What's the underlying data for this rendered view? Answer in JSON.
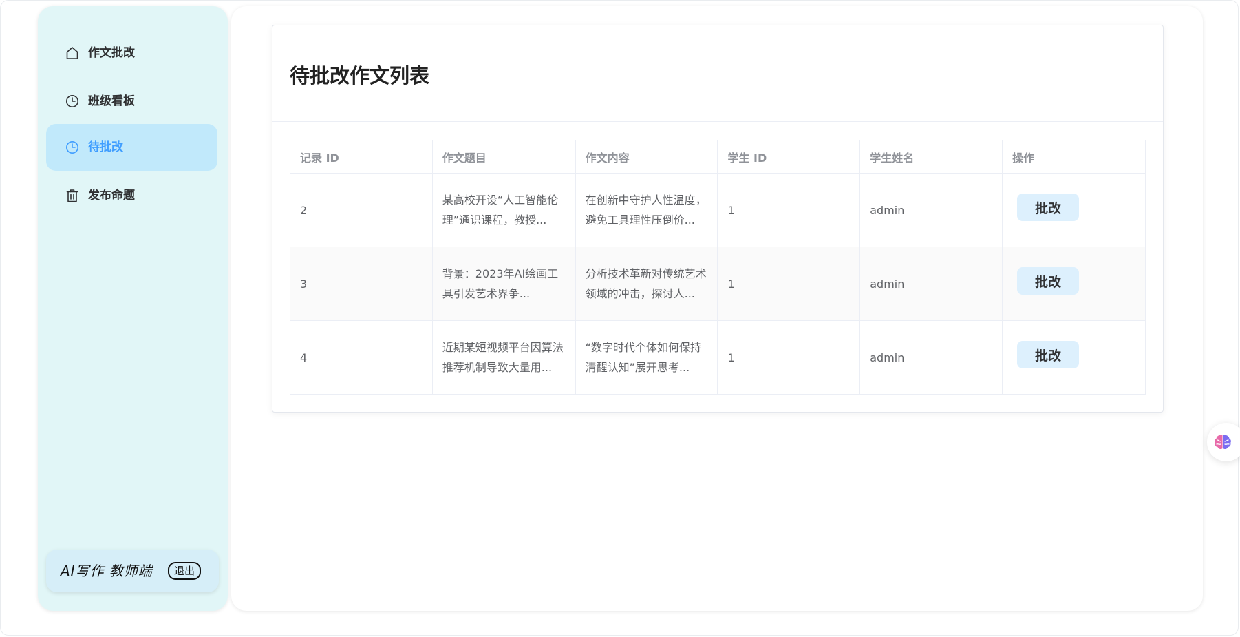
{
  "sidebar": {
    "items": [
      {
        "label": "作文批改",
        "icon": "home-icon",
        "active": false
      },
      {
        "label": "班级看板",
        "icon": "clock-icon",
        "active": false
      },
      {
        "label": "待批改",
        "icon": "clock-icon",
        "active": true
      },
      {
        "label": "发布命题",
        "icon": "trash-icon",
        "active": false
      }
    ],
    "footer": {
      "brand": "AI写作 教师端",
      "logout_label": "退出"
    }
  },
  "main": {
    "card_title": "待批改作文列表",
    "table": {
      "columns": [
        "记录 ID",
        "作文题目",
        "作文内容",
        "学生 ID",
        "学生姓名",
        "操作"
      ],
      "rows": [
        {
          "record_id": "2",
          "title": "某高校开设“人工智能伦理”通识课程，教授...",
          "content": "在创新中守护人性温度，避免工具理性压倒价...",
          "student_id": "1",
          "student_name": "admin",
          "action": "批改"
        },
        {
          "record_id": "3",
          "title": "背景：2023年AI绘画工具引发艺术界争...",
          "content": "分析技术革新对传统艺术领域的冲击，探讨人...",
          "student_id": "1",
          "student_name": "admin",
          "action": "批改"
        },
        {
          "record_id": "4",
          "title": "近期某短视频平台因算法推荐机制导致大量用...",
          "content": "“数字时代个体如何保持清醒认知”展开思考...",
          "student_id": "1",
          "student_name": "admin",
          "action": "批改"
        }
      ]
    }
  },
  "floating_button": {
    "icon": "brain-icon"
  },
  "colors": {
    "sidebar_bg": "#e1f6f7",
    "active_item_bg": "#c1e9fb",
    "active_text": "#409eff",
    "button_bg": "#ddf0fd"
  }
}
